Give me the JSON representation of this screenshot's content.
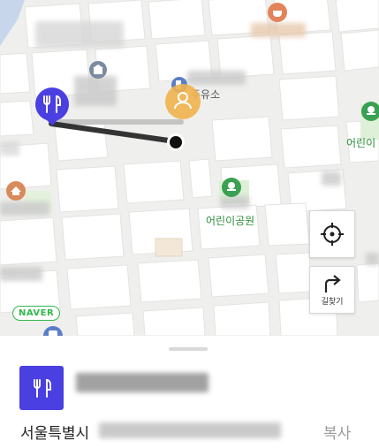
{
  "map": {
    "gas_station_label": "주유소",
    "playground_label_1": "어린이공원",
    "playground_label_2": "어린이",
    "naver_logo": "NAVER",
    "colors": {
      "route": "#333333",
      "marker": "#4a3fe0",
      "gas": "#f0b24d",
      "park": "#3aa052"
    }
  },
  "controls": {
    "locate_icon": "crosshair-icon",
    "directions_label": "길찾기",
    "directions_icon": "turn-right-arrow-icon"
  },
  "place": {
    "category_icon": "fork-knife-icon",
    "address_prefix": "서울특별시",
    "copy_label": "복사"
  }
}
